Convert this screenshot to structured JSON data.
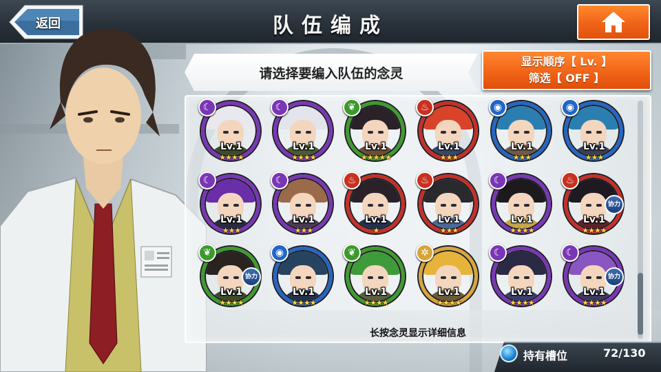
{
  "header": {
    "title": "队伍编成",
    "back_label": "返回"
  },
  "prompt": "请选择要编入队伍的念灵",
  "sort_filter": {
    "sort_line": "显示顺序【 Lv. 】",
    "filter_line": "筛选【 OFF 】"
  },
  "hint": "长按念灵显示详细信息",
  "slots": {
    "label": "持有槽位",
    "count": "72/130"
  },
  "grid": [
    {
      "lv": "Lv.1",
      "stars": "★★★★",
      "element": "dark",
      "ring": "#7a36b6",
      "elem_color": "#7a36b6",
      "elem_glyph": "☾",
      "hair": "#e8e8ee",
      "body": "#3d4a2e",
      "assist": ""
    },
    {
      "lv": "Lv.1",
      "stars": "★★★★",
      "element": "dark",
      "ring": "#7a36b6",
      "elem_color": "#7a36b6",
      "elem_glyph": "☾",
      "hair": "#e4e4ec",
      "body": "#4a5a38",
      "assist": ""
    },
    {
      "lv": "Lv.1",
      "stars": "★★★★★",
      "element": "wind",
      "ring": "#3f9a2e",
      "elem_color": "#3c9a2c",
      "elem_glyph": "❦",
      "hair": "#2a2228",
      "body": "#6a4e3a",
      "assist": ""
    },
    {
      "lv": "Lv.1",
      "stars": "★★★",
      "element": "fire",
      "ring": "#c62f26",
      "elem_color": "#c9301f",
      "elem_glyph": "♨",
      "hair": "#d8432a",
      "body": "#3a4766",
      "assist": ""
    },
    {
      "lv": "Lv.1",
      "stars": "★★★",
      "element": "water",
      "ring": "#2566c2",
      "elem_color": "#2166c4",
      "elem_glyph": "◉",
      "hair": "#2a7fb0",
      "body": "#6d5a4a",
      "assist": ""
    },
    {
      "lv": "Lv.1",
      "stars": "★★★",
      "element": "water",
      "ring": "#2566c2",
      "elem_color": "#2166c4",
      "elem_glyph": "◉",
      "hair": "#2a7fb0",
      "body": "#3a3f52",
      "assist": ""
    },
    {
      "lv": "Lv.1",
      "stars": "★★★",
      "element": "dark",
      "ring": "#7a36b6",
      "elem_color": "#7a36b6",
      "elem_glyph": "☾",
      "hair": "#6a2ea8",
      "body": "#2b2b40",
      "assist": ""
    },
    {
      "lv": "Lv.1",
      "stars": "★★★",
      "element": "dark",
      "ring": "#7a36b6",
      "elem_color": "#7a36b6",
      "elem_glyph": "☾",
      "hair": "#9a6a4a",
      "body": "#4c3a52",
      "assist": ""
    },
    {
      "lv": "Lv.1",
      "stars": "★",
      "element": "fire",
      "ring": "#c62f26",
      "elem_color": "#c9301f",
      "elem_glyph": "♨",
      "hair": "#2a2228",
      "body": "#23314d",
      "assist": ""
    },
    {
      "lv": "Lv.1",
      "stars": "★★★",
      "element": "fire",
      "ring": "#c62f26",
      "elem_color": "#c9301f",
      "elem_glyph": "♨",
      "hair": "#2a2a2e",
      "body": "#4a6a9a",
      "assist": ""
    },
    {
      "lv": "Lv.1",
      "stars": "★★★★",
      "element": "dark",
      "ring": "#7a36b6",
      "elem_color": "#7a36b6",
      "elem_glyph": "☾",
      "hair": "#1d1a1e",
      "body": "#c8a64a",
      "assist": ""
    },
    {
      "lv": "Lv.1",
      "stars": "★★★★",
      "element": "fire",
      "ring": "#c62f26",
      "elem_color": "#c9301f",
      "elem_glyph": "♨",
      "hair": "#1d1a22",
      "body": "#5a2328",
      "assist": "协力"
    },
    {
      "lv": "Lv.1",
      "stars": "★★★★",
      "element": "wind",
      "ring": "#3f9a2e",
      "elem_color": "#3c9a2c",
      "elem_glyph": "❦",
      "hair": "#2a2420",
      "body": "#3d4a2a",
      "assist": "协力"
    },
    {
      "lv": "Lv.1",
      "stars": "★★★★",
      "element": "water",
      "ring": "#2566c2",
      "elem_color": "#2166c4",
      "elem_glyph": "◉",
      "hair": "#26445f",
      "body": "#24324a",
      "assist": ""
    },
    {
      "lv": "Lv.1",
      "stars": "★★★★",
      "element": "wind",
      "ring": "#3f9a2e",
      "elem_color": "#3c9a2c",
      "elem_glyph": "❦",
      "hair": "#3f9a3a",
      "body": "#5a5f40",
      "assist": ""
    },
    {
      "lv": "Lv.1",
      "stars": "★★★★",
      "element": "light",
      "ring": "#d8a53c",
      "elem_color": "#d6a43a",
      "elem_glyph": "✲",
      "hair": "#e6b43a",
      "body": "#6d5a36",
      "assist": ""
    },
    {
      "lv": "Lv.1",
      "stars": "★★★★",
      "element": "dark",
      "ring": "#7a36b6",
      "elem_color": "#7a36b6",
      "elem_glyph": "☾",
      "hair": "#2a2a44",
      "body": "#3a3f6a",
      "assist": ""
    },
    {
      "lv": "Lv.1",
      "stars": "★★★★",
      "element": "dark",
      "ring": "#7a36b6",
      "elem_color": "#7a36b6",
      "elem_glyph": "☾",
      "hair": "#8a56c2",
      "body": "#3f3a5a",
      "assist": "协力"
    }
  ]
}
